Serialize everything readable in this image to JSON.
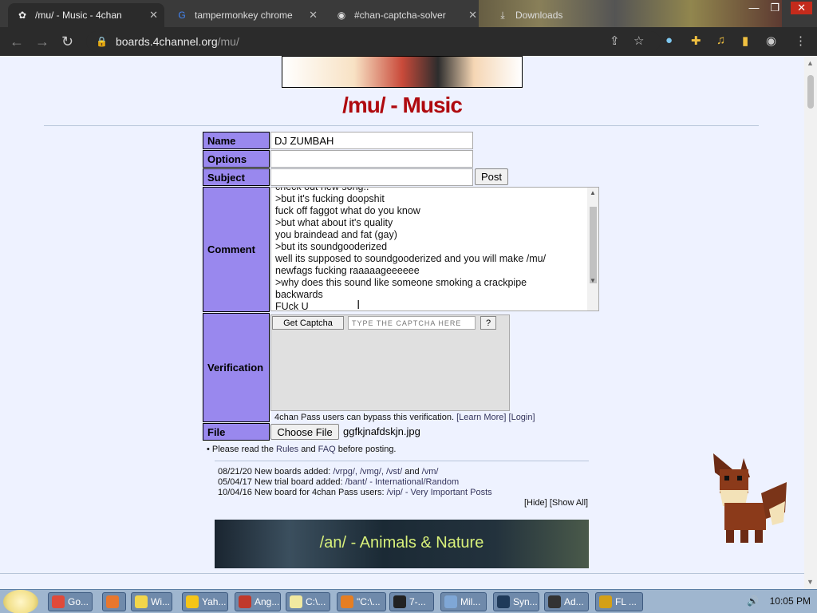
{
  "browser": {
    "tabs": [
      {
        "title": "/mu/ - Music - 4chan",
        "active": true
      },
      {
        "title": "tampermonkey chrome",
        "active": false
      },
      {
        "title": "#chan-captcha-solver",
        "active": false
      },
      {
        "title": "Downloads",
        "active": false
      }
    ],
    "address": {
      "host": "boards.4channel.org",
      "path": "/mu/"
    }
  },
  "page": {
    "board_title": "/mu/ - Music",
    "form": {
      "name_label": "Name",
      "name_value": "DJ ZUMBAH",
      "options_label": "Options",
      "options_value": "",
      "subject_label": "Subject",
      "subject_value": "",
      "post_button": "Post",
      "comment_label": "Comment",
      "comment_lines": [
        "check out new song..",
        ">but it's fucking doopshit",
        "fuck off faggot what do you know",
        ">but what about it's quality",
        "you braindead and fat (gay)",
        ">but its soundgooderized",
        "well its supposed to soundgooderized and you will make /mu/",
        "newfags fucking raaaaageeeeee",
        ">why does this sound like someone smoking a crackpipe",
        "backwards",
        "FUck U"
      ],
      "verification_label": "Verification",
      "get_captcha_button": "Get Captcha",
      "captcha_placeholder": "TYPE THE CAPTCHA HERE",
      "captcha_help": "?",
      "bypass_text": "4chan Pass users can bypass this verification.",
      "learn_more": "[Learn More]",
      "login": "[Login]",
      "file_label": "File",
      "choose_file_button": "Choose File",
      "file_name": "ggfkjnafdskjn.jpg"
    },
    "rules_prefix": "• Please read the",
    "rules_link": "Rules",
    "rules_and": "and",
    "faq_link": "FAQ",
    "rules_suffix": "before posting.",
    "news": [
      {
        "date": "08/21/20",
        "text": "New boards added:",
        "links": "/vrpg/, /vmg/, /vst/",
        "extra_and": "and",
        "extra": "/vm/"
      },
      {
        "date": "05/04/17",
        "text": "New trial board added:",
        "links": "/bant/ - International/Random",
        "extra_and": "",
        "extra": ""
      },
      {
        "date": "10/04/16",
        "text": "New board for 4chan Pass users:",
        "links": "/vip/ - Very Important Posts",
        "extra_and": "",
        "extra": ""
      }
    ],
    "hide": "[Hide]",
    "show_all": "[Show All]",
    "ad_text": "/an/ - Animals & Nature"
  },
  "taskbar": {
    "items": [
      "Go...",
      "",
      "Wi...",
      "Yah...",
      "Ang...",
      "C:\\...",
      "\"C:\\...",
      "7-...",
      "Mil...",
      "Syn...",
      "Ad...",
      "FL ..."
    ],
    "clock": "10:05 PM"
  },
  "colors": {
    "label_bg": "#9988ee",
    "title_red": "#af0a0f",
    "link": "#34345c",
    "page_bg": "#eef2ff"
  }
}
